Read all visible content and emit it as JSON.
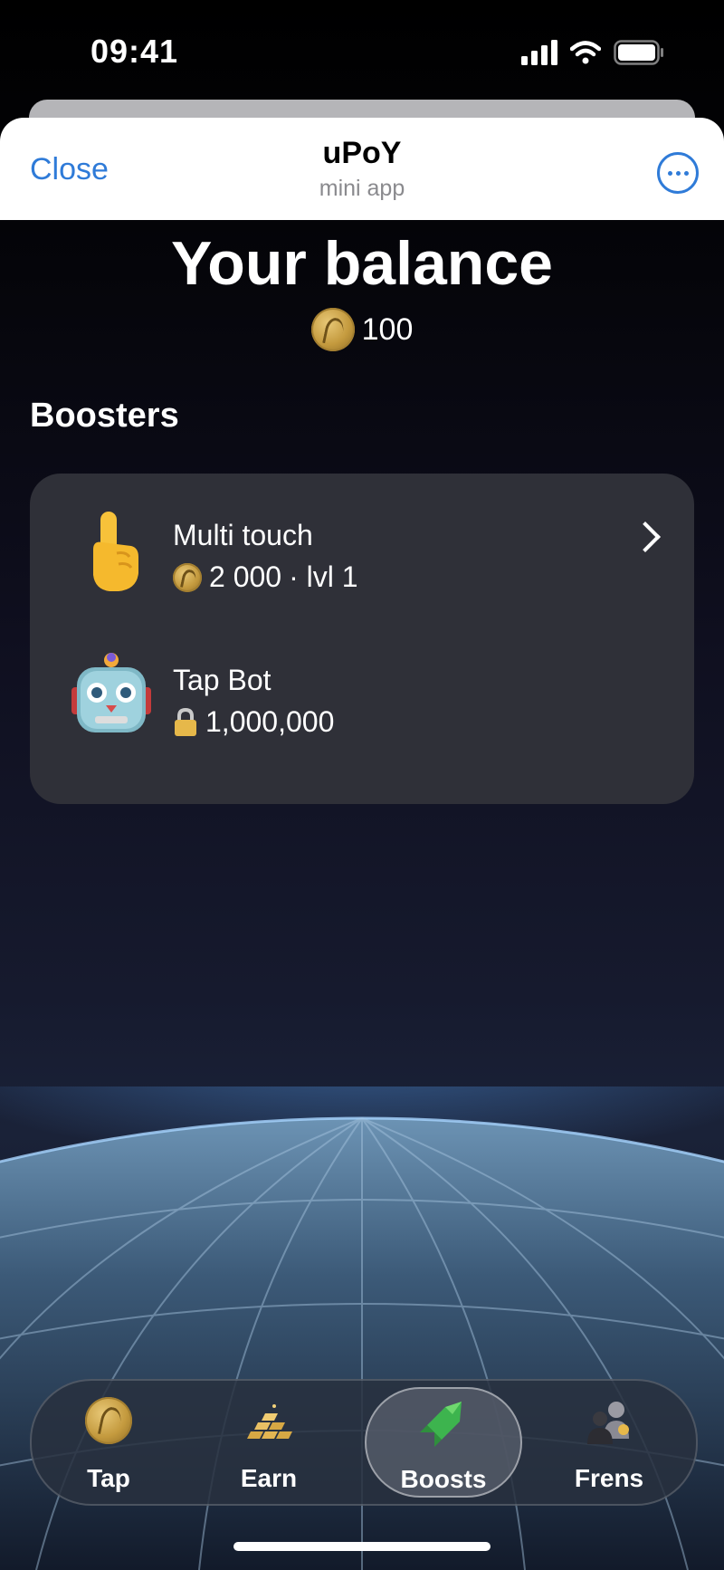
{
  "status_bar": {
    "time": "09:41"
  },
  "header": {
    "close_label": "Close",
    "title": "uPoY",
    "subtitle": "mini app"
  },
  "balance": {
    "title": "Your balance",
    "value": "100"
  },
  "boosters": {
    "heading": "Boosters",
    "items": [
      {
        "name": "Multi touch",
        "price": "2 000",
        "level": "· lvl 1",
        "icon": "pointing-finger-icon",
        "locked": false
      },
      {
        "name": "Tap Bot",
        "price": "1,000,000",
        "icon": "robot-icon",
        "locked": true
      }
    ]
  },
  "tabs": [
    {
      "label": "Tap",
      "icon": "coin-icon",
      "active": false
    },
    {
      "label": "Earn",
      "icon": "gold-bars-icon",
      "active": false
    },
    {
      "label": "Boosts",
      "icon": "rocket-icon",
      "active": true
    },
    {
      "label": "Frens",
      "icon": "friends-icon",
      "active": false
    }
  ],
  "colors": {
    "accent": "#2f7bd8",
    "card": "#2f3038",
    "background": "#000000"
  }
}
